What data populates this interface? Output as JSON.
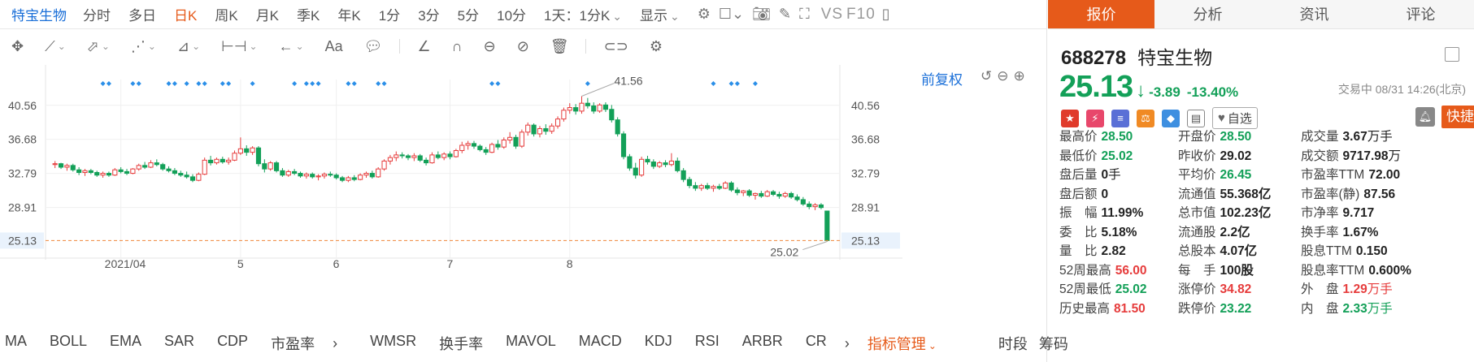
{
  "toolbar": {
    "stock_name": "特宝生物",
    "periods": [
      "分时",
      "多日",
      "日K",
      "周K",
      "月K",
      "季K",
      "年K",
      "1分",
      "3分",
      "5分",
      "10分"
    ],
    "active_period": "日K",
    "interval_select": "1天：1分K",
    "display_select": "显示",
    "vs_label": "VS",
    "f10_label": "F10"
  },
  "chart": {
    "adjust_label": "前复权",
    "y_ticks": [
      "40.56",
      "36.68",
      "32.79",
      "28.91",
      "25.13"
    ],
    "x_ticks": [
      "2021/04",
      "5",
      "6",
      "7",
      "8"
    ],
    "high_label": "41.56",
    "low_label": "25.02",
    "current_price_label": "25.13"
  },
  "chart_data": {
    "type": "candlestick",
    "y_range": [
      23.5,
      43.5
    ],
    "current_price": 25.13,
    "max_annotation": 41.56,
    "min_annotation": 25.02,
    "x_ticks": [
      "2021/04",
      "5",
      "6",
      "7",
      "8"
    ],
    "ohlc": [
      [
        33.8,
        34.2,
        33.4,
        33.9
      ],
      [
        33.9,
        34.0,
        33.3,
        33.5
      ],
      [
        33.5,
        33.9,
        33.1,
        33.7
      ],
      [
        33.7,
        33.9,
        33.0,
        33.2
      ],
      [
        33.2,
        33.5,
        32.6,
        32.9
      ],
      [
        32.9,
        33.3,
        32.5,
        33.1
      ],
      [
        33.1,
        33.3,
        32.7,
        32.9
      ],
      [
        32.9,
        33.1,
        32.4,
        32.6
      ],
      [
        32.6,
        33.0,
        32.3,
        32.8
      ],
      [
        32.8,
        33.0,
        32.4,
        32.6
      ],
      [
        32.6,
        33.4,
        32.5,
        33.2
      ],
      [
        33.2,
        33.5,
        32.8,
        33.0
      ],
      [
        33.0,
        33.3,
        32.6,
        32.8
      ],
      [
        32.8,
        33.4,
        32.7,
        33.3
      ],
      [
        33.3,
        33.9,
        33.1,
        33.7
      ],
      [
        33.7,
        34.1,
        33.3,
        33.5
      ],
      [
        33.5,
        34.3,
        33.4,
        34.0
      ],
      [
        34.0,
        34.4,
        33.6,
        33.8
      ],
      [
        33.8,
        34.0,
        33.1,
        33.3
      ],
      [
        33.3,
        33.6,
        32.9,
        33.1
      ],
      [
        33.1,
        33.4,
        32.6,
        32.8
      ],
      [
        32.8,
        33.1,
        32.4,
        32.6
      ],
      [
        32.6,
        33.0,
        32.2,
        32.4
      ],
      [
        32.4,
        32.7,
        31.8,
        32.0
      ],
      [
        32.0,
        32.9,
        31.9,
        32.7
      ],
      [
        32.7,
        34.6,
        32.6,
        34.3
      ],
      [
        34.3,
        34.8,
        33.7,
        34.0
      ],
      [
        34.0,
        34.6,
        33.8,
        34.4
      ],
      [
        34.4,
        34.7,
        33.9,
        34.1
      ],
      [
        34.1,
        34.6,
        33.8,
        34.3
      ],
      [
        34.3,
        35.4,
        34.2,
        35.1
      ],
      [
        35.1,
        36.9,
        34.9,
        35.6
      ],
      [
        35.6,
        36.0,
        34.8,
        35.2
      ],
      [
        35.2,
        35.9,
        34.9,
        35.7
      ],
      [
        35.7,
        35.9,
        33.6,
        33.9
      ],
      [
        33.9,
        34.4,
        32.9,
        33.3
      ],
      [
        33.3,
        34.2,
        33.1,
        34.0
      ],
      [
        34.0,
        34.2,
        32.9,
        33.1
      ],
      [
        33.1,
        33.4,
        32.4,
        32.6
      ],
      [
        32.6,
        33.2,
        32.4,
        33.0
      ],
      [
        33.0,
        33.3,
        32.6,
        32.8
      ],
      [
        32.8,
        33.0,
        32.3,
        32.5
      ],
      [
        32.5,
        32.9,
        32.2,
        32.7
      ],
      [
        32.7,
        32.9,
        32.2,
        32.4
      ],
      [
        32.4,
        32.7,
        32.0,
        32.5
      ],
      [
        32.5,
        32.9,
        32.2,
        32.7
      ],
      [
        32.7,
        33.0,
        32.4,
        32.6
      ],
      [
        32.6,
        32.8,
        32.1,
        32.3
      ],
      [
        32.3,
        32.5,
        31.8,
        32.0
      ],
      [
        32.0,
        32.5,
        31.8,
        32.3
      ],
      [
        32.3,
        32.6,
        31.9,
        32.1
      ],
      [
        32.1,
        32.8,
        32.0,
        32.6
      ],
      [
        32.6,
        33.0,
        32.3,
        32.8
      ],
      [
        32.8,
        33.1,
        32.2,
        32.4
      ],
      [
        32.4,
        33.5,
        32.3,
        33.3
      ],
      [
        33.3,
        34.4,
        33.1,
        34.2
      ],
      [
        34.2,
        34.9,
        33.8,
        34.6
      ],
      [
        34.6,
        35.3,
        34.2,
        34.9
      ],
      [
        34.9,
        35.2,
        34.5,
        34.8
      ],
      [
        34.8,
        35.0,
        34.3,
        34.6
      ],
      [
        34.6,
        35.1,
        34.2,
        34.8
      ],
      [
        34.8,
        35.0,
        34.1,
        34.3
      ],
      [
        34.3,
        34.6,
        33.7,
        34.0
      ],
      [
        34.0,
        35.2,
        33.9,
        34.9
      ],
      [
        34.9,
        35.3,
        34.4,
        34.6
      ],
      [
        34.6,
        35.2,
        34.3,
        35.0
      ],
      [
        35.0,
        35.3,
        34.4,
        34.7
      ],
      [
        34.7,
        35.6,
        34.6,
        35.4
      ],
      [
        35.4,
        36.4,
        35.1,
        36.0
      ],
      [
        36.0,
        36.5,
        35.5,
        36.2
      ],
      [
        36.2,
        36.5,
        35.6,
        35.9
      ],
      [
        35.9,
        36.1,
        35.3,
        35.5
      ],
      [
        35.5,
        35.8,
        34.9,
        35.2
      ],
      [
        35.2,
        36.3,
        35.1,
        36.1
      ],
      [
        36.1,
        36.6,
        35.5,
        35.8
      ],
      [
        35.8,
        36.9,
        35.6,
        36.6
      ],
      [
        36.6,
        37.5,
        36.2,
        36.9
      ],
      [
        36.9,
        37.2,
        35.6,
        35.9
      ],
      [
        35.9,
        37.8,
        35.7,
        37.5
      ],
      [
        37.5,
        38.6,
        37.1,
        38.3
      ],
      [
        38.3,
        38.5,
        37.0,
        37.3
      ],
      [
        37.3,
        38.2,
        36.9,
        37.9
      ],
      [
        37.9,
        38.4,
        37.2,
        37.6
      ],
      [
        37.6,
        38.5,
        37.3,
        38.2
      ],
      [
        38.2,
        39.3,
        37.9,
        39.0
      ],
      [
        39.0,
        40.3,
        38.7,
        40.0
      ],
      [
        40.0,
        40.8,
        39.6,
        40.3
      ],
      [
        40.3,
        40.7,
        39.5,
        39.9
      ],
      [
        39.9,
        41.6,
        39.6,
        40.8
      ],
      [
        40.8,
        41.4,
        40.2,
        40.5
      ],
      [
        40.5,
        40.9,
        39.6,
        39.9
      ],
      [
        39.9,
        40.8,
        39.7,
        40.6
      ],
      [
        40.6,
        40.9,
        39.8,
        40.1
      ],
      [
        40.1,
        40.6,
        38.6,
        38.9
      ],
      [
        38.9,
        39.2,
        37.0,
        37.3
      ],
      [
        37.3,
        37.6,
        34.4,
        34.7
      ],
      [
        34.7,
        35.0,
        33.1,
        33.4
      ],
      [
        33.4,
        34.0,
        32.2,
        32.6
      ],
      [
        32.6,
        34.7,
        32.4,
        34.4
      ],
      [
        34.4,
        34.8,
        33.8,
        34.1
      ],
      [
        34.1,
        34.4,
        33.3,
        33.6
      ],
      [
        33.6,
        34.2,
        33.4,
        34.0
      ],
      [
        34.0,
        34.3,
        33.5,
        33.8
      ],
      [
        33.8,
        35.1,
        33.6,
        34.2
      ],
      [
        34.2,
        34.6,
        32.9,
        33.1
      ],
      [
        33.1,
        33.4,
        31.8,
        32.1
      ],
      [
        32.1,
        32.4,
        31.1,
        31.4
      ],
      [
        31.4,
        31.8,
        30.8,
        31.1
      ],
      [
        31.1,
        31.6,
        30.8,
        31.4
      ],
      [
        31.4,
        31.7,
        30.9,
        31.1
      ],
      [
        31.1,
        31.5,
        30.7,
        31.3
      ],
      [
        31.3,
        31.6,
        30.9,
        31.1
      ],
      [
        31.1,
        31.9,
        31.0,
        31.7
      ],
      [
        31.7,
        31.9,
        30.7,
        30.9
      ],
      [
        30.9,
        31.2,
        30.3,
        30.6
      ],
      [
        30.6,
        30.9,
        30.2,
        30.8
      ],
      [
        30.8,
        31.0,
        30.1,
        30.3
      ],
      [
        30.3,
        30.6,
        29.8,
        30.5
      ],
      [
        30.5,
        30.8,
        30.0,
        30.2
      ],
      [
        30.2,
        30.9,
        30.1,
        30.7
      ],
      [
        30.7,
        30.9,
        30.2,
        30.4
      ],
      [
        30.4,
        30.7,
        29.9,
        30.2
      ],
      [
        30.2,
        30.7,
        30.0,
        30.5
      ],
      [
        30.5,
        30.7,
        29.9,
        30.1
      ],
      [
        30.1,
        30.4,
        29.6,
        29.8
      ],
      [
        29.8,
        30.1,
        29.1,
        29.3
      ],
      [
        29.3,
        29.6,
        28.7,
        29.0
      ],
      [
        29.0,
        29.4,
        28.6,
        29.2
      ],
      [
        29.2,
        29.4,
        28.7,
        28.9
      ],
      [
        28.5,
        28.5,
        25.02,
        25.13
      ]
    ],
    "markers_count": 27
  },
  "indicators": {
    "items": [
      "MA",
      "BOLL",
      "EMA",
      "SAR",
      "CDP",
      "市盈率"
    ],
    "items2": [
      "WMSR",
      "换手率",
      "MAVOL",
      "MACD",
      "KDJ",
      "RSI",
      "ARBR",
      "CR"
    ],
    "manager_label": "指标管理",
    "right_items": [
      "时段",
      "筹码"
    ]
  },
  "tabs": [
    "报价",
    "分析",
    "资讯",
    "评论"
  ],
  "active_tab": "报价",
  "quote": {
    "code": "688278",
    "name": "特宝生物",
    "price": "25.13",
    "change": "-3.89",
    "change_pct": "-13.40%",
    "status": "交易中 08/31 14:26(北京)",
    "watch_label": "自选",
    "trade_label": "快捷交易"
  },
  "stats": [
    [
      {
        "l": "最高价",
        "v": "28.50",
        "c": "green"
      },
      {
        "l": "开盘价",
        "v": "28.50",
        "c": "green"
      },
      {
        "l": "成交量",
        "v": "3.67",
        "u": "万手",
        "c": ""
      }
    ],
    [
      {
        "l": "最低价",
        "v": "25.02",
        "c": "green"
      },
      {
        "l": "昨收价",
        "v": "29.02",
        "c": ""
      },
      {
        "l": "成交额",
        "v": "9717.98",
        "u": "万",
        "c": ""
      }
    ],
    [
      {
        "l": "盘后量",
        "v": "0",
        "u": "手",
        "c": ""
      },
      {
        "l": "平均价",
        "v": "26.45",
        "c": "green"
      },
      {
        "l": "市盈率TTM",
        "v": "72.00",
        "c": ""
      }
    ],
    [
      {
        "l": "盘后额",
        "v": "0",
        "c": ""
      },
      {
        "l": "流通值",
        "v": "55.368亿",
        "c": ""
      },
      {
        "l": "市盈率(静)",
        "v": "87.56",
        "c": ""
      }
    ],
    [
      {
        "l": "振　幅",
        "v": "11.99%",
        "c": ""
      },
      {
        "l": "总市值",
        "v": "102.23亿",
        "c": ""
      },
      {
        "l": "市净率",
        "v": "9.717",
        "c": ""
      }
    ],
    [
      {
        "l": "委　比",
        "v": "5.18%",
        "c": ""
      },
      {
        "l": "流通股",
        "v": "2.2亿",
        "c": ""
      },
      {
        "l": "换手率",
        "v": "1.67%",
        "c": ""
      }
    ],
    [
      {
        "l": "量　比",
        "v": "2.82",
        "c": ""
      },
      {
        "l": "总股本",
        "v": "4.07亿",
        "c": ""
      },
      {
        "l": "股息TTM",
        "v": "0.150",
        "c": ""
      }
    ],
    [
      {
        "l": "52周最高",
        "v": "56.00",
        "c": "red"
      },
      {
        "l": "每　手",
        "v": "100股",
        "c": ""
      },
      {
        "l": "股息率TTM",
        "v": "0.600%",
        "c": ""
      }
    ],
    [
      {
        "l": "52周最低",
        "v": "25.02",
        "c": "green"
      },
      {
        "l": "涨停价",
        "v": "34.82",
        "c": "red"
      },
      {
        "l": "外　盘",
        "v": "1.29",
        "u": "万手",
        "c": "red"
      }
    ],
    [
      {
        "l": "历史最高",
        "v": "81.50",
        "c": "red"
      },
      {
        "l": "跌停价",
        "v": "23.22",
        "c": "green"
      },
      {
        "l": "内　盘",
        "v": "2.33",
        "u": "万手",
        "c": "green"
      }
    ]
  ]
}
